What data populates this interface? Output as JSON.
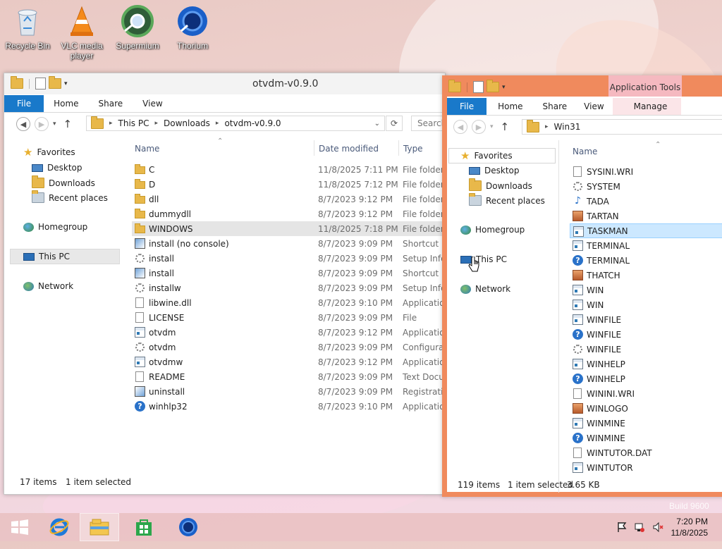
{
  "desktop": {
    "icons": [
      {
        "label": "Recycle Bin",
        "icon": "recycle-bin-icon"
      },
      {
        "label": "VLC media player",
        "icon": "vlc-icon"
      },
      {
        "label": "Supermium",
        "icon": "supermium-icon"
      },
      {
        "label": "Thorium",
        "icon": "thorium-icon"
      }
    ],
    "build_text": "Build 9600"
  },
  "window1": {
    "title": "otvdm-v0.9.0",
    "tabs": [
      "File",
      "Home",
      "Share",
      "View"
    ],
    "breadcrumb": [
      "This PC",
      "Downloads",
      "otvdm-v0.9.0"
    ],
    "search_placeholder": "Search",
    "nav": {
      "favorites": "Favorites",
      "desktop": "Desktop",
      "downloads": "Downloads",
      "recent": "Recent places",
      "homegroup": "Homegroup",
      "this_pc": "This PC",
      "network": "Network"
    },
    "columns": {
      "name": "Name",
      "date": "Date modified",
      "type": "Type"
    },
    "files": [
      {
        "name": "C",
        "date": "11/8/2025 7:11 PM",
        "type": "File folder",
        "icon": "folder"
      },
      {
        "name": "D",
        "date": "11/8/2025 7:12 PM",
        "type": "File folder",
        "icon": "folder"
      },
      {
        "name": "dll",
        "date": "8/7/2023 9:12 PM",
        "type": "File folder",
        "icon": "folder"
      },
      {
        "name": "dummydll",
        "date": "8/7/2023 9:12 PM",
        "type": "File folder",
        "icon": "folder"
      },
      {
        "name": "WINDOWS",
        "date": "11/8/2025 7:18 PM",
        "type": "File folder",
        "icon": "folder",
        "selected": true
      },
      {
        "name": "install (no console)",
        "date": "8/7/2023 9:09 PM",
        "type": "Shortcut",
        "icon": "setup"
      },
      {
        "name": "install",
        "date": "8/7/2023 9:09 PM",
        "type": "Setup Infor",
        "icon": "gear"
      },
      {
        "name": "install",
        "date": "8/7/2023 9:09 PM",
        "type": "Shortcut",
        "icon": "setup"
      },
      {
        "name": "installw",
        "date": "8/7/2023 9:09 PM",
        "type": "Setup Infor",
        "icon": "gear"
      },
      {
        "name": "libwine.dll",
        "date": "8/7/2023 9:10 PM",
        "type": "Application",
        "icon": "doc"
      },
      {
        "name": "LICENSE",
        "date": "8/7/2023 9:09 PM",
        "type": "File",
        "icon": "doc"
      },
      {
        "name": "otvdm",
        "date": "8/7/2023 9:12 PM",
        "type": "Application",
        "icon": "app"
      },
      {
        "name": "otvdm",
        "date": "8/7/2023 9:09 PM",
        "type": "Configurat",
        "icon": "gear"
      },
      {
        "name": "otvdmw",
        "date": "8/7/2023 9:12 PM",
        "type": "Application",
        "icon": "app"
      },
      {
        "name": "README",
        "date": "8/7/2023 9:09 PM",
        "type": "Text Docu",
        "icon": "doc"
      },
      {
        "name": "uninstall",
        "date": "8/7/2023 9:09 PM",
        "type": "Registration",
        "icon": "reg"
      },
      {
        "name": "winhlp32",
        "date": "8/7/2023 9:10 PM",
        "type": "Application",
        "icon": "help"
      }
    ],
    "status_count": "17 items",
    "status_selected": "1 item selected"
  },
  "window2": {
    "context_tab": "Application Tools",
    "tabs": [
      "File",
      "Home",
      "Share",
      "View",
      "Manage"
    ],
    "breadcrumb": [
      "Win31"
    ],
    "nav": {
      "favorites": "Favorites",
      "desktop": "Desktop",
      "downloads": "Downloads",
      "recent": "Recent places",
      "homegroup": "Homegroup",
      "this_pc": "This PC",
      "network": "Network"
    },
    "columns": {
      "name": "Name"
    },
    "files": [
      {
        "name": "SYSINI.WRI",
        "icon": "doc"
      },
      {
        "name": "SYSTEM",
        "icon": "gear"
      },
      {
        "name": "TADA",
        "icon": "note"
      },
      {
        "name": "TARTAN",
        "icon": "pic"
      },
      {
        "name": "TASKMAN",
        "icon": "app",
        "selected": true
      },
      {
        "name": "TERMINAL",
        "icon": "app"
      },
      {
        "name": "TERMINAL",
        "icon": "help"
      },
      {
        "name": "THATCH",
        "icon": "pic"
      },
      {
        "name": "WIN",
        "icon": "app"
      },
      {
        "name": "WIN",
        "icon": "app"
      },
      {
        "name": "WINFILE",
        "icon": "app"
      },
      {
        "name": "WINFILE",
        "icon": "help"
      },
      {
        "name": "WINFILE",
        "icon": "gear"
      },
      {
        "name": "WINHELP",
        "icon": "app"
      },
      {
        "name": "WINHELP",
        "icon": "help"
      },
      {
        "name": "WININI.WRI",
        "icon": "doc"
      },
      {
        "name": "WINLOGO",
        "icon": "pic"
      },
      {
        "name": "WINMINE",
        "icon": "app"
      },
      {
        "name": "WINMINE",
        "icon": "help"
      },
      {
        "name": "WINTUTOR.DAT",
        "icon": "doc"
      },
      {
        "name": "WINTUTOR",
        "icon": "app"
      }
    ],
    "status_count": "119 items",
    "status_selected": "1 item selected",
    "status_size": "3.65 KB"
  },
  "taskbar": {
    "time": "7:20 PM",
    "date": "11/8/2025"
  },
  "colors": {
    "accent": "#1979ca",
    "window2_frame": "#f08a5d",
    "context_tab": "#f5b9c0"
  }
}
